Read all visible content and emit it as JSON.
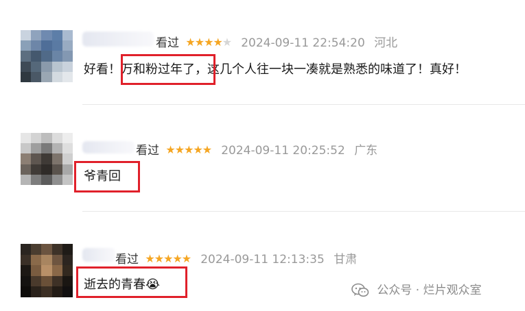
{
  "reviews": [
    {
      "status": "看过",
      "stars_filled": 4,
      "stars_total": 5,
      "timestamp": "2024-09-11 22:54:20",
      "location": "河北",
      "text_parts": [
        "好看！",
        "万和粉过年了，",
        "这几个人往一块一凑就是熟悉的味道了！真好！"
      ]
    },
    {
      "status": "看过",
      "stars_filled": 5,
      "stars_total": 5,
      "timestamp": "2024-09-11 20:25:52",
      "location": "广东",
      "text_parts": [
        "爷青回"
      ]
    },
    {
      "status": "看过",
      "stars_filled": 5,
      "stars_total": 5,
      "timestamp": "2024-09-11 12:13:35",
      "location": "甘肃",
      "text_parts": [
        "逝去的青春",
        "😭"
      ]
    }
  ],
  "stars": {
    "filled_glyph": "★",
    "empty_glyph": "★",
    "filled_color": "#f5a623",
    "empty_color": "#d6d6d6"
  },
  "highlight_color": "#e0202a",
  "watermark": {
    "icon": "wechat-icon",
    "text": "公众号 · 烂片观众室"
  }
}
